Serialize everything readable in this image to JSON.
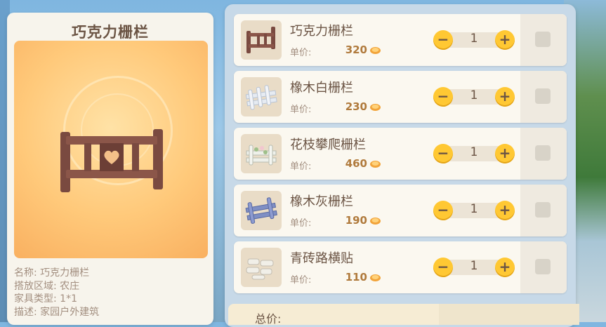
{
  "detail": {
    "title": "巧克力栅栏",
    "info": [
      {
        "label": "名称:",
        "value": "巧克力栅栏"
      },
      {
        "label": "搭放区域:",
        "value": "农庄"
      },
      {
        "label": "家具类型:",
        "value": "1*1"
      },
      {
        "label": "描述:",
        "value": "家园户外建筑"
      }
    ]
  },
  "price_label": "单价:",
  "items": [
    {
      "name": "巧克力栅栏",
      "price": "320",
      "qty": "1",
      "icon": "chocolate-fence-icon"
    },
    {
      "name": "橡木白栅栏",
      "price": "230",
      "qty": "1",
      "icon": "white-oak-fence-icon"
    },
    {
      "name": "花枝攀爬栅栏",
      "price": "460",
      "qty": "1",
      "icon": "flower-vine-fence-icon"
    },
    {
      "name": "橡木灰栅栏",
      "price": "190",
      "qty": "1",
      "icon": "gray-oak-fence-icon"
    },
    {
      "name": "青砖路横贴",
      "price": "110",
      "qty": "1",
      "icon": "blue-brick-path-icon"
    }
  ],
  "stepper": {
    "minus": "−",
    "plus": "+"
  },
  "total": {
    "label": "总价:"
  },
  "colors": {
    "accent": "#ffc833",
    "text": "#6b5444",
    "price": "#b07a3c"
  }
}
